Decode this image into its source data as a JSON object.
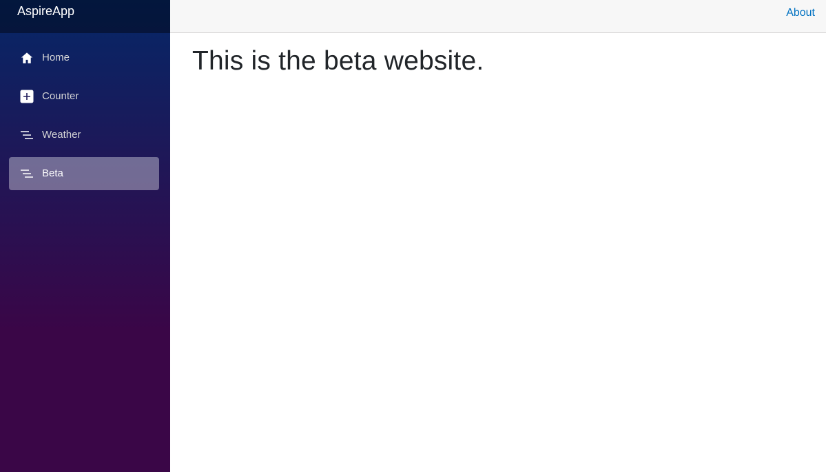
{
  "app": {
    "brand": "AspireApp"
  },
  "sidebar": {
    "items": [
      {
        "label": "Home",
        "icon": "home-icon",
        "active": false
      },
      {
        "label": "Counter",
        "icon": "plus-square-icon",
        "active": false
      },
      {
        "label": "Weather",
        "icon": "list-icon",
        "active": false
      },
      {
        "label": "Beta",
        "icon": "list-icon",
        "active": true
      }
    ]
  },
  "topbar": {
    "about_label": "About"
  },
  "main": {
    "heading": "This is the beta website."
  },
  "colors": {
    "sidebar_gradient_top": "#052767",
    "sidebar_gradient_bottom": "#3a0647",
    "link": "#0071c1",
    "topbar_bg": "#f7f7f7"
  }
}
